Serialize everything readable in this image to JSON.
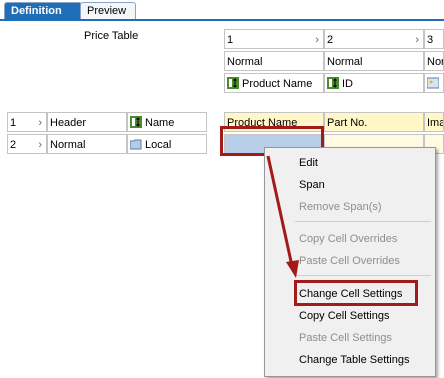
{
  "tabs": {
    "definition": "Definition",
    "preview": "Preview"
  },
  "price_table_label": "Price Table",
  "top_grid": {
    "col1": {
      "index": "1",
      "type": "Normal",
      "field": "Product Name"
    },
    "col2": {
      "index": "2",
      "type": "Normal",
      "field": "ID"
    },
    "col3": {
      "index": "3",
      "type": "Norm"
    }
  },
  "left_grid": {
    "rows": [
      {
        "index": "1",
        "type": "Header",
        "field": "Name"
      },
      {
        "index": "2",
        "type": "Normal",
        "field": "Local"
      }
    ]
  },
  "table_headers": {
    "col1": "Product Name",
    "col2": "Part No.",
    "col3": "Imag"
  },
  "context_menu": {
    "edit": "Edit",
    "span": "Span",
    "remove_span": "Remove Span(s)",
    "copy_cell_overrides": "Copy Cell Overrides",
    "paste_cell_overrides": "Paste Cell Overrides",
    "change_cell_settings": "Change Cell Settings",
    "copy_cell_settings": "Copy Cell Settings",
    "paste_cell_settings": "Paste Cell Settings",
    "change_table_settings": "Change Table Settings"
  },
  "colors": {
    "tab_active": "#1f6fb8",
    "highlight": "#a21a1a",
    "header_yellow": "#fff7c8",
    "selection": "#b9cfe9"
  }
}
